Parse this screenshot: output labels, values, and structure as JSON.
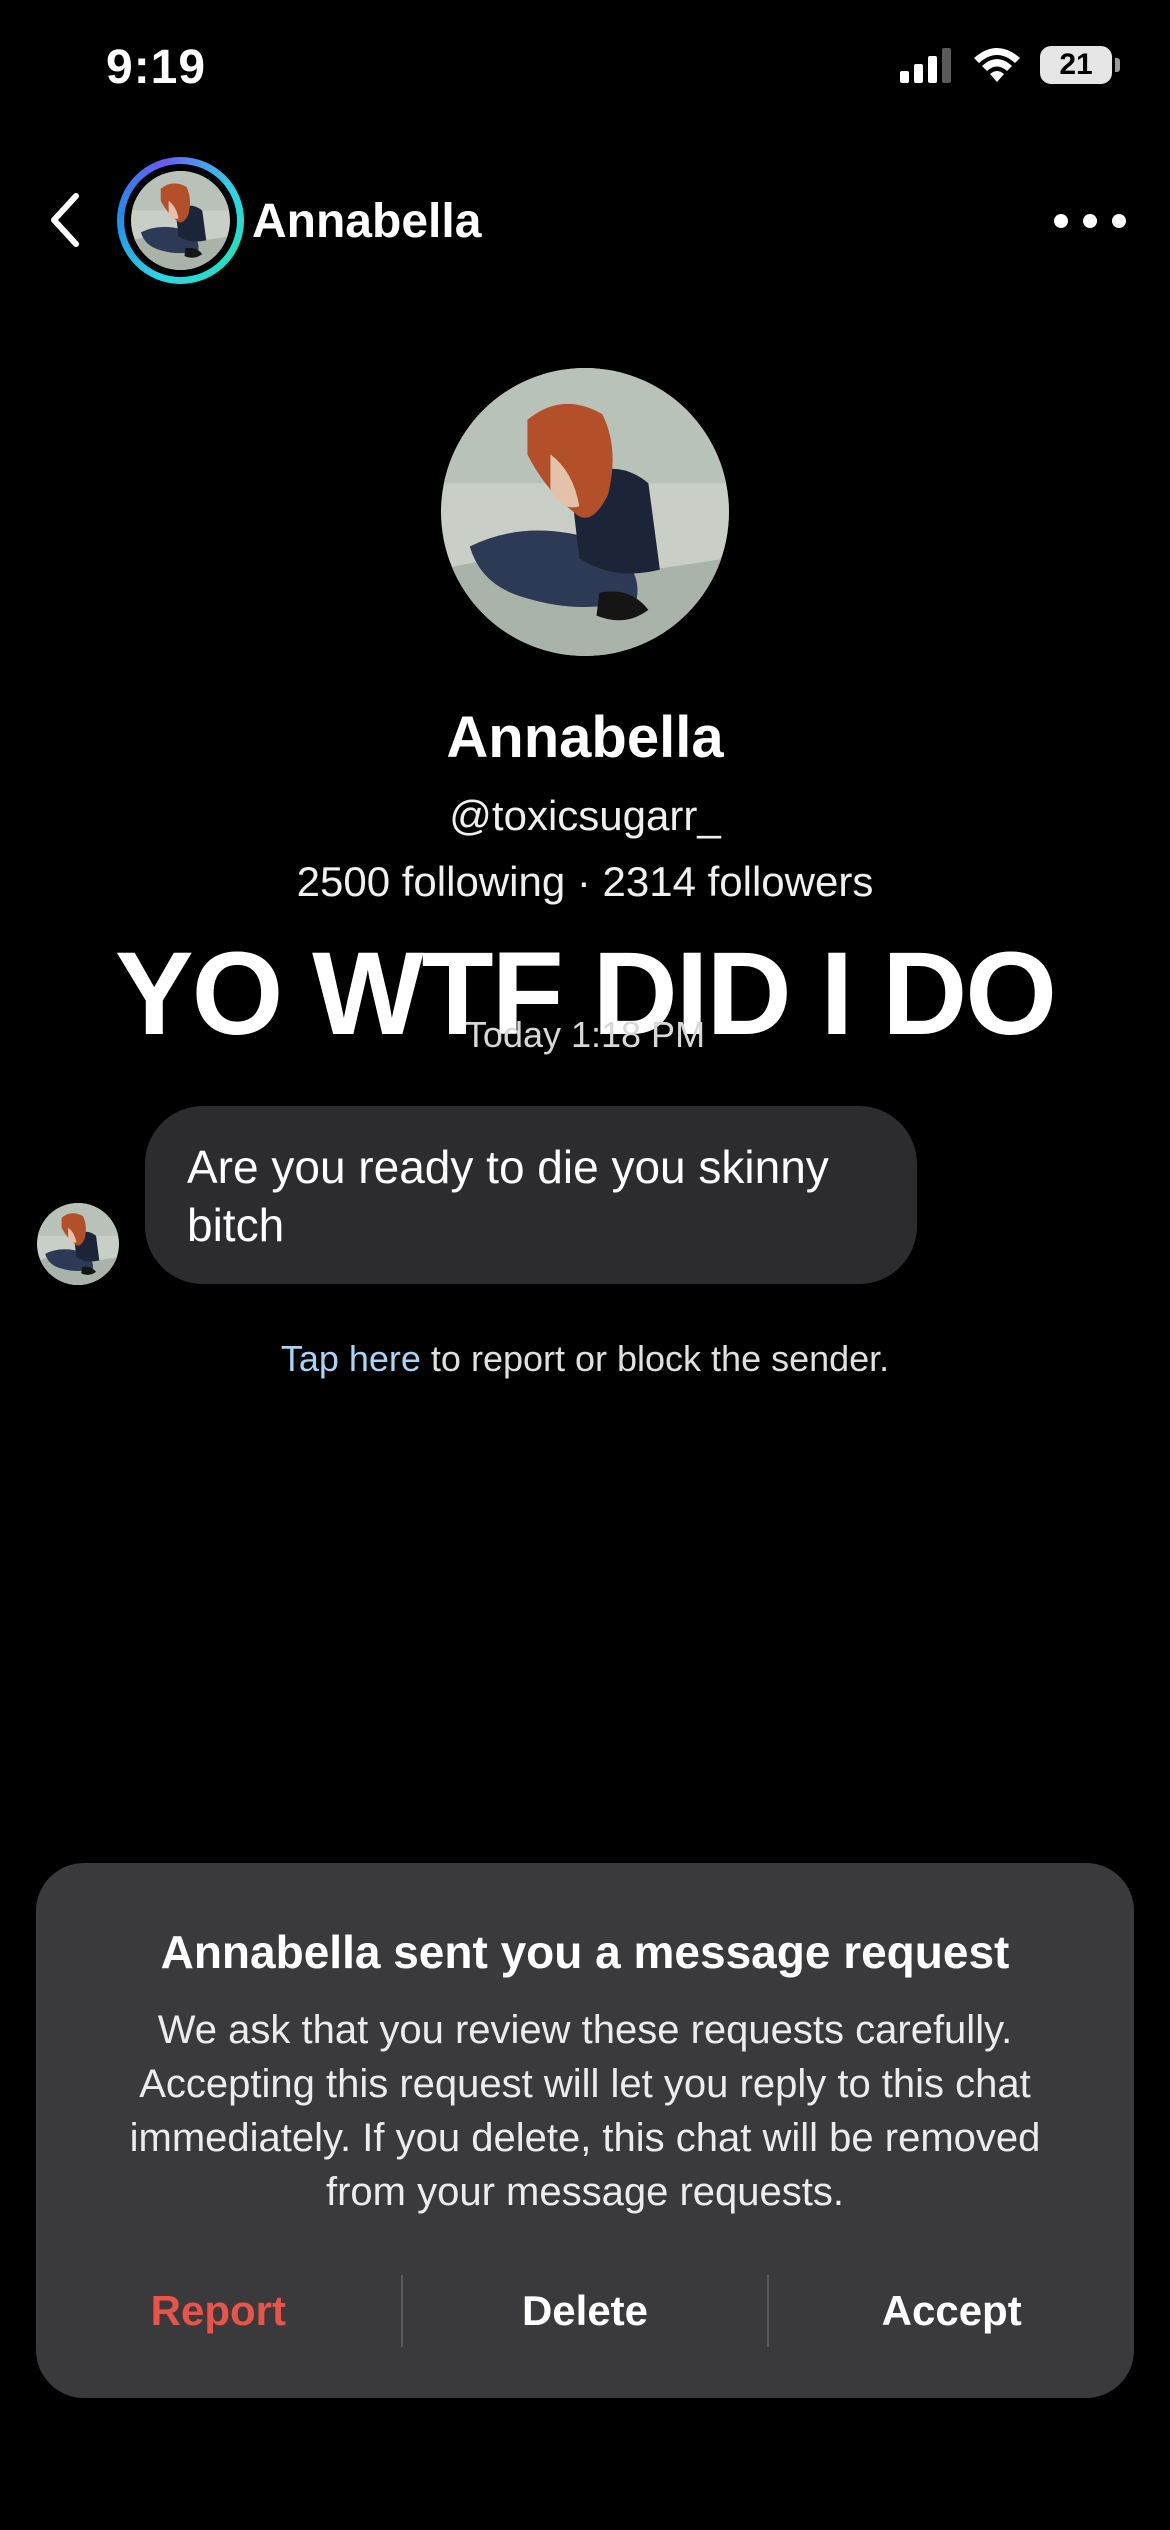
{
  "status_bar": {
    "time": "9:19",
    "battery": "21"
  },
  "header": {
    "name": "Annabella"
  },
  "profile": {
    "name": "Annabella",
    "handle": "@toxicsugarr_",
    "stats": "2500 following · 2314 followers"
  },
  "overlay_caption": "YO WTF DID I DO",
  "thread": {
    "timestamp": "Today 1:18 PM",
    "message": "Are you ready to die you skinny bitch"
  },
  "report_hint": {
    "link": "Tap here",
    "text": " to report or block the sender."
  },
  "request_sheet": {
    "title": "Annabella sent you a message request",
    "body": "We ask that you review these requests carefully. Accepting this request will let you reply to this chat immediately. If you delete, this chat will be removed from your message requests.",
    "report_label": "Report",
    "delete_label": "Delete",
    "accept_label": "Accept"
  },
  "colors": {
    "report": "#e8544a",
    "link": "#a9d4f5",
    "bubble": "#2c2c2e",
    "sheet": "#3a3a3c",
    "story_ring": "#30d4e6"
  },
  "icons": [
    "signal-icon",
    "wifi-icon",
    "battery-icon",
    "back-chevron-icon",
    "more-dots-icon"
  ]
}
